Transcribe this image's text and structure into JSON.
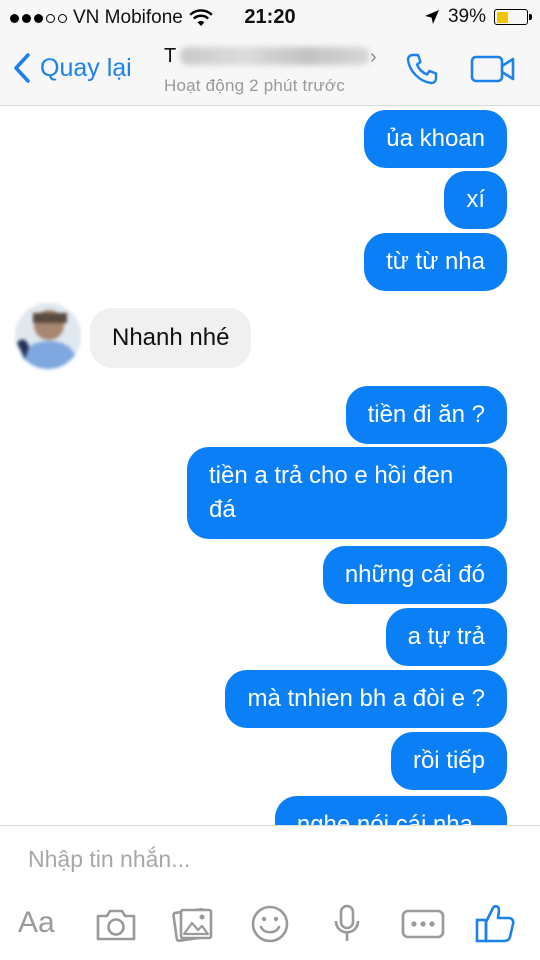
{
  "status": {
    "carrier": "VN Mobifone",
    "time": "21:20",
    "battery": "39%",
    "battery_level": 0.39
  },
  "header": {
    "back_label": "Quay lại",
    "name_initial": "T",
    "status": "Hoạt động 2 phút trước"
  },
  "messages": [
    {
      "side": "out",
      "text": "ủa khoan"
    },
    {
      "side": "out",
      "text": "xí"
    },
    {
      "side": "out",
      "text": "từ từ nha"
    },
    {
      "side": "in",
      "text": "Nhanh nhé"
    },
    {
      "side": "out",
      "text": "tiền đi ăn ?"
    },
    {
      "side": "out",
      "text": "tiền a trả cho e hồi đen đá"
    },
    {
      "side": "out",
      "text": "những cái đó"
    },
    {
      "side": "out",
      "text": "a tự trả"
    },
    {
      "side": "out",
      "text": "mà tnhien bh a đòi e ?"
    },
    {
      "side": "out",
      "text": "rồi tiếp"
    },
    {
      "side": "out",
      "text": "nghe nói cái nha"
    }
  ],
  "composer": {
    "placeholder": "Nhập tin nhắn...",
    "aa_label": "Aa"
  },
  "icons": [
    "back-chevron-icon",
    "phone-icon",
    "video-camera-icon",
    "camera-icon",
    "photo-gallery-icon",
    "emoji-icon",
    "microphone-icon",
    "more-icon",
    "like-icon"
  ],
  "colors": {
    "accent": "#1a82ea",
    "outgoing_bubble": "#0b7ff5",
    "incoming_bubble": "#f0f0f0",
    "battery": "#f5c400"
  }
}
